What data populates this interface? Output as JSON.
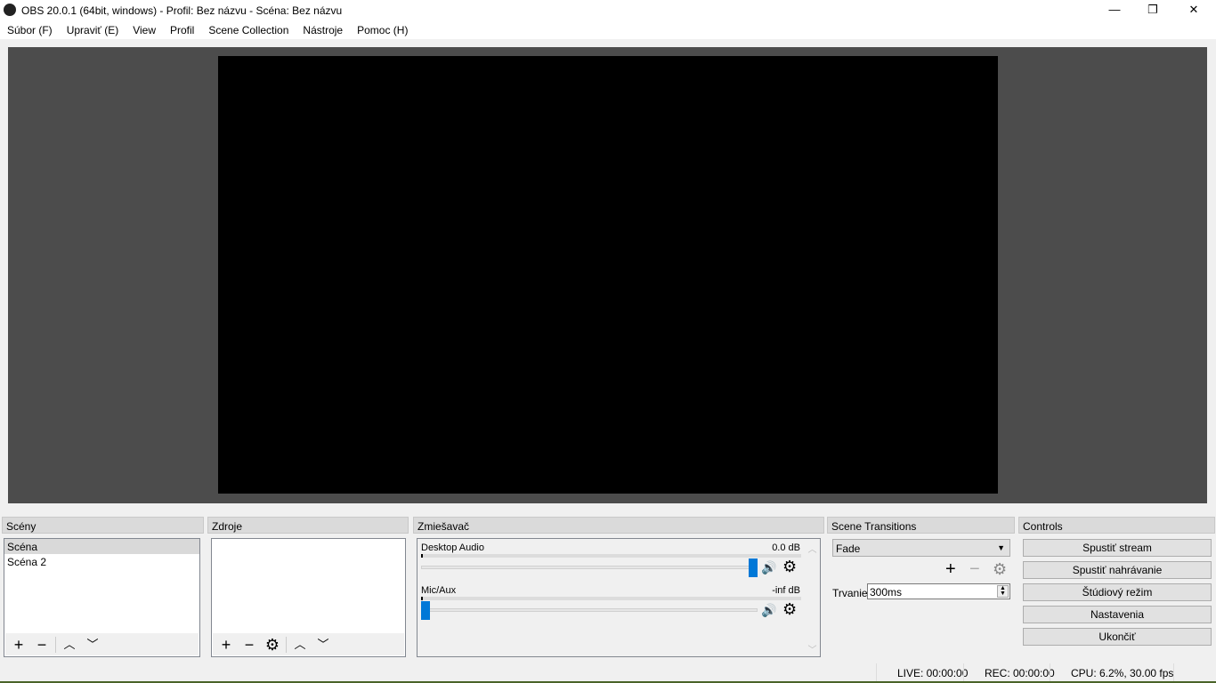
{
  "window": {
    "title": "OBS 20.0.1 (64bit, windows) - Profil: Bez názvu - Scéna: Bez názvu",
    "min": "—",
    "max": "❐",
    "close": "✕"
  },
  "menu": [
    "Súbor (F)",
    "Upraviť (E)",
    "View",
    "Profil",
    "Scene Collection",
    "Nástroje",
    "Pomoc (H)"
  ],
  "docks": {
    "scenes": "Scény",
    "sources": "Zdroje",
    "mixer": "Zmiešavač",
    "transitions": "Scene Transitions",
    "controls": "Controls"
  },
  "scenes": [
    "Scéna",
    "Scéna 2"
  ],
  "mixer": [
    {
      "name": "Desktop Audio",
      "db": "0.0 dB",
      "volume": 1.0
    },
    {
      "name": "Mic/Aux",
      "db": "-inf dB",
      "volume": 0.0
    }
  ],
  "transitions": {
    "selected": "Fade",
    "duration_label": "Trvanie",
    "duration": "300ms"
  },
  "controls": [
    "Spustiť stream",
    "Spustiť nahrávanie",
    "Štúdiový režim",
    "Nastavenia",
    "Ukončiť"
  ],
  "status": {
    "live": "LIVE: 00:00:00",
    "rec": "REC: 00:00:00",
    "cpu": "CPU: 6.2%, 30.00 fps"
  },
  "icons": {
    "plus": "+",
    "minus": "−",
    "up": "︿",
    "down": "﹀",
    "gear": "⚙",
    "speaker": "🔊",
    "dropdown": "▼"
  }
}
